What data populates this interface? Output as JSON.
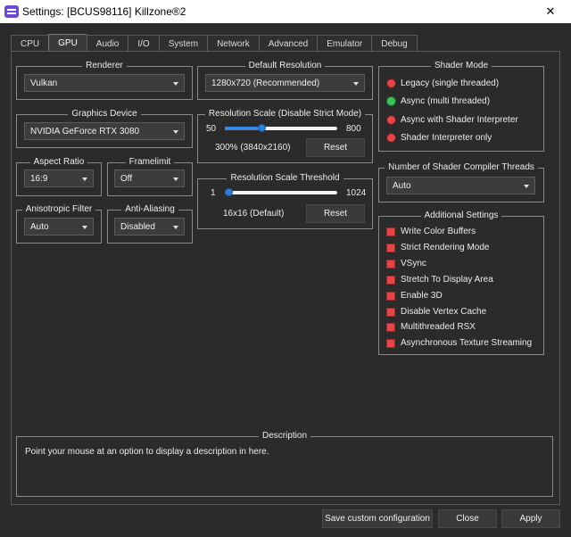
{
  "window": {
    "title": "Settings: [BCUS98116] Killzone®2"
  },
  "tabs": [
    "CPU",
    "GPU",
    "Audio",
    "I/O",
    "System",
    "Network",
    "Advanced",
    "Emulator",
    "Debug"
  ],
  "renderer": {
    "title": "Renderer",
    "value": "Vulkan"
  },
  "graphics_device": {
    "title": "Graphics Device",
    "value": "NVIDIA GeForce RTX 3080"
  },
  "aspect_ratio": {
    "title": "Aspect Ratio",
    "value": "16:9"
  },
  "framelimit": {
    "title": "Framelimit",
    "value": "Off"
  },
  "anisotropic": {
    "title": "Anisotropic Filter",
    "value": "Auto"
  },
  "anti_aliasing": {
    "title": "Anti-Aliasing",
    "value": "Disabled"
  },
  "default_resolution": {
    "title": "Default Resolution",
    "value": "1280x720 (Recommended)"
  },
  "resolution_scale": {
    "title": "Resolution Scale (Disable Strict Mode)",
    "min": "50",
    "max": "800",
    "value_text": "300% (3840x2160)",
    "level": 0.333,
    "reset": "Reset"
  },
  "resolution_threshold": {
    "title": "Resolution Scale Threshold",
    "min": "1",
    "max": "1024",
    "value_text": "16x16 (Default)",
    "level": 0.015,
    "reset": "Reset"
  },
  "shader_mode": {
    "title": "Shader Mode",
    "options": [
      {
        "label": "Legacy (single threaded)",
        "selected": false
      },
      {
        "label": "Async (multi threaded)",
        "selected": true
      },
      {
        "label": "Async with Shader Interpreter",
        "selected": false
      },
      {
        "label": "Shader Interpreter only",
        "selected": false
      }
    ]
  },
  "compiler_threads": {
    "title": "Number of Shader Compiler Threads",
    "value": "Auto"
  },
  "additional_settings": {
    "title": "Additional Settings",
    "items": [
      "Write Color Buffers",
      "Strict Rendering Mode",
      "VSync",
      "Stretch To Display Area",
      "Enable 3D",
      "Disable Vertex Cache",
      "Multithreaded RSX",
      "Asynchronous Texture Streaming"
    ]
  },
  "description": {
    "title": "Description",
    "text": "Point your mouse at an option to display a description in here."
  },
  "footer": {
    "save_custom": "Save custom configuration",
    "close": "Close",
    "apply": "Apply"
  },
  "colors": {
    "accent": "#3c8ae0",
    "checkbox_off": "#e64545",
    "radio_on": "#39c45a"
  }
}
